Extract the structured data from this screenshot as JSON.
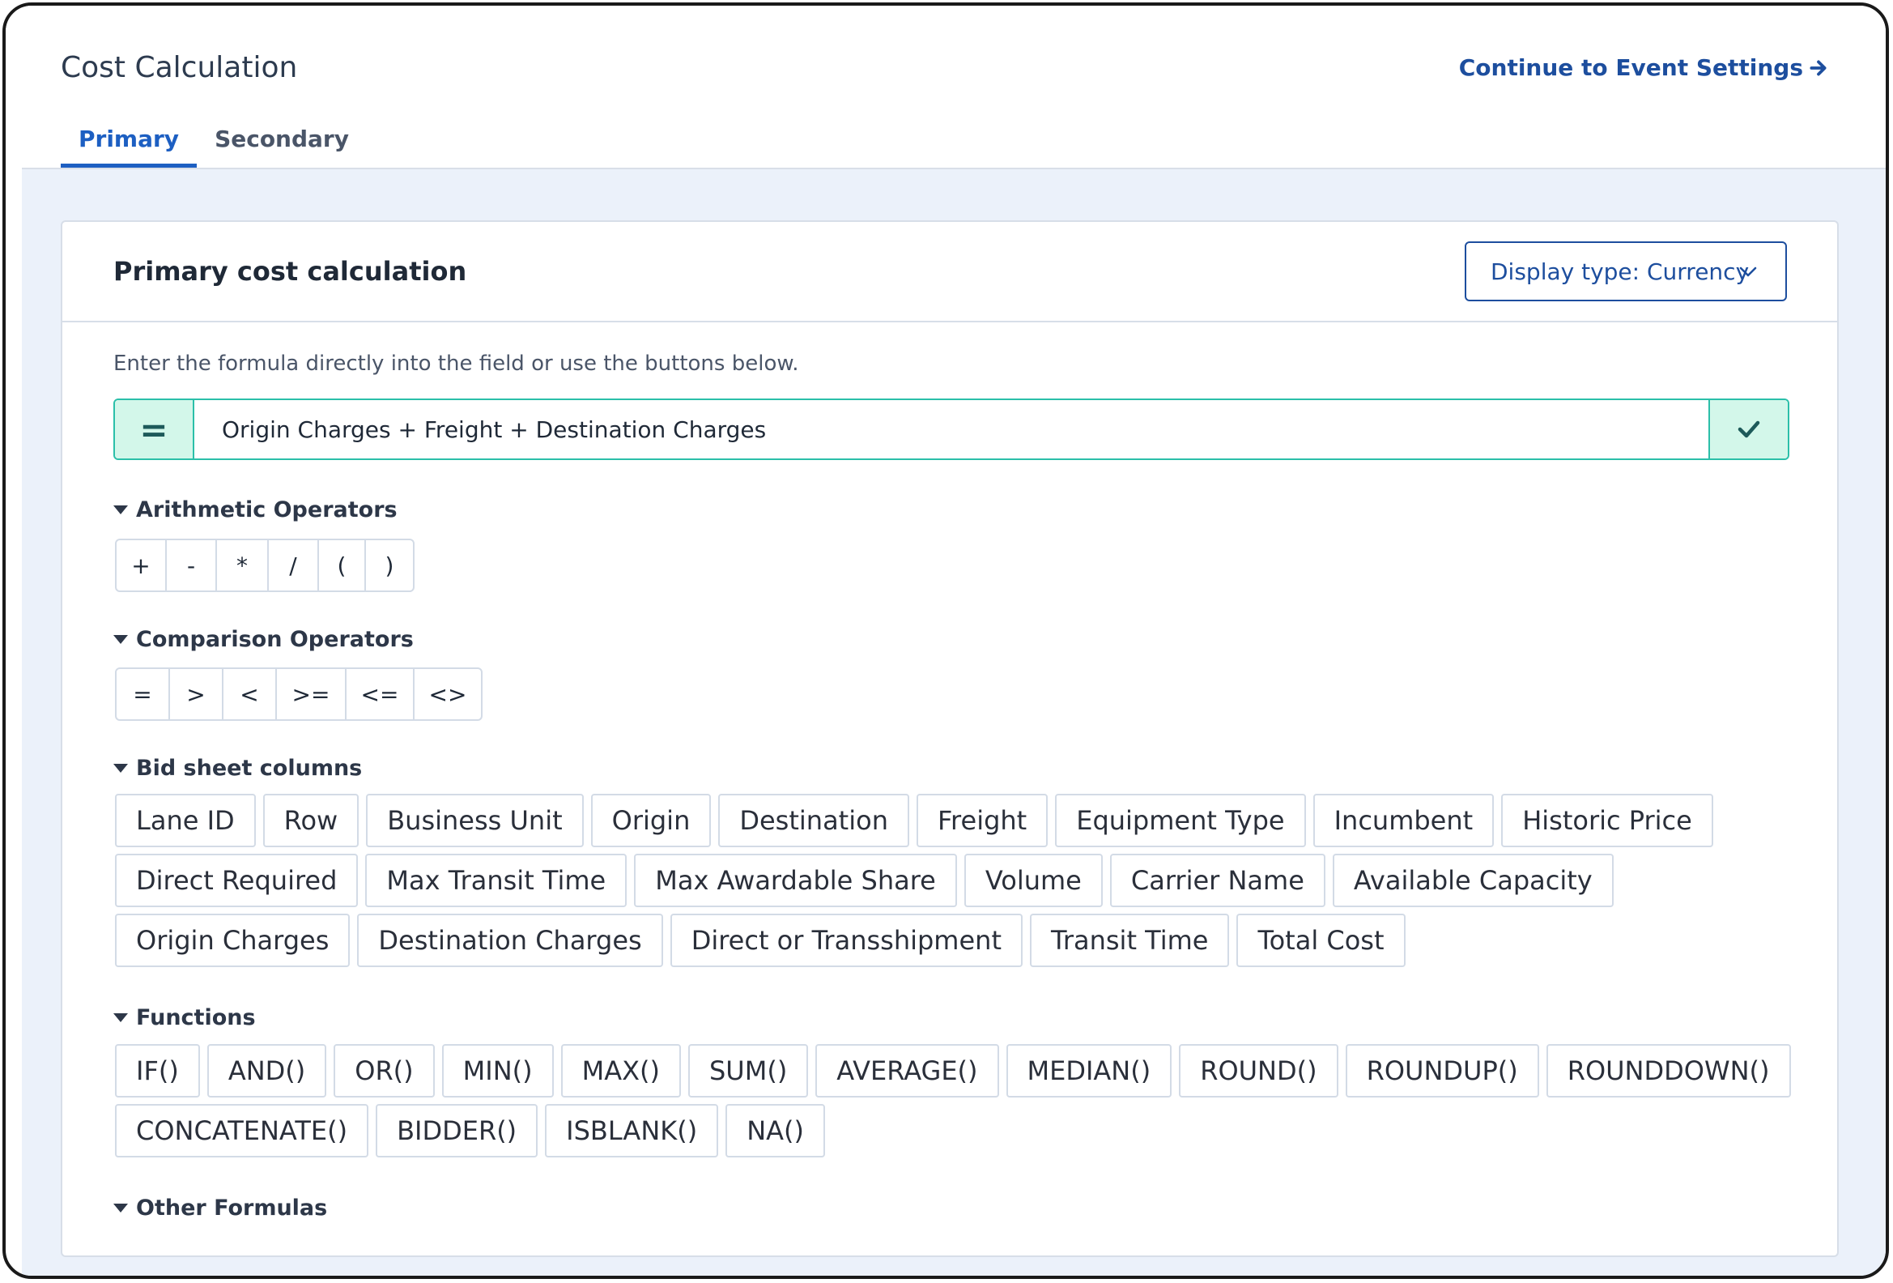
{
  "header": {
    "title": "Cost Calculation",
    "continue_label": "Continue to Event Settings"
  },
  "tabs": [
    {
      "label": "Primary",
      "active": true
    },
    {
      "label": "Secondary",
      "active": false
    }
  ],
  "card": {
    "title": "Primary cost calculation",
    "display_select": "Display type: Currency",
    "hint": "Enter the formula directly into the field or use the buttons below.",
    "formula": {
      "prefix": "=",
      "value": "Origin Charges + Freight + Destination Charges"
    }
  },
  "sections": {
    "arithmetic": {
      "label": "Arithmetic Operators",
      "ops": [
        "+",
        "-",
        "*",
        "/",
        "(",
        ")"
      ]
    },
    "comparison": {
      "label": "Comparison Operators",
      "ops": [
        "=",
        ">",
        "<",
        ">=",
        "<=",
        "<>"
      ]
    },
    "columns": {
      "label": "Bid sheet columns",
      "items": [
        "Lane ID",
        "Row",
        "Business Unit",
        "Origin",
        "Destination",
        "Freight",
        "Equipment Type",
        "Incumbent",
        "Historic Price",
        "Direct Required",
        "Max Transit Time",
        "Max Awardable Share",
        "Volume",
        "Carrier Name",
        "Available Capacity",
        "Origin Charges",
        "Destination Charges",
        "Direct or Transshipment",
        "Transit Time",
        "Total Cost"
      ]
    },
    "functions": {
      "label": "Functions",
      "items": [
        "IF()",
        "AND()",
        "OR()",
        "MIN()",
        "MAX()",
        "SUM()",
        "AVERAGE()",
        "MEDIAN()",
        "ROUND()",
        "ROUNDUP()",
        "ROUNDDOWN()",
        "CONCATENATE()",
        "BIDDER()",
        "ISBLANK()",
        "NA()"
      ]
    },
    "other": {
      "label": "Other Formulas"
    }
  },
  "colors": {
    "accent": "#1d5fc2",
    "link": "#1d4e9e",
    "formula_border": "#2bbfa9",
    "formula_fill": "#d3f7ea",
    "canvas": "#ebf1fa"
  }
}
